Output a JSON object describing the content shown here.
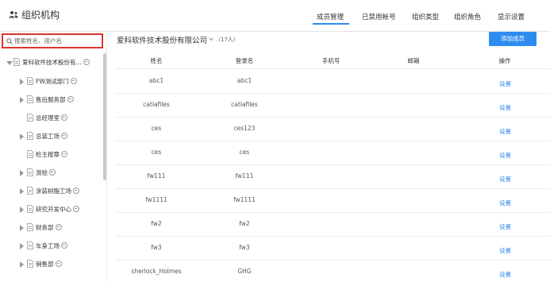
{
  "header": {
    "title": "组织机构",
    "icon": "org-users-icon",
    "tabs": [
      {
        "label": "成员管理",
        "active": true
      },
      {
        "label": "已禁用帐号",
        "active": false
      },
      {
        "label": "组织类型",
        "active": false
      },
      {
        "label": "组织角色",
        "active": false
      },
      {
        "label": "显示设置",
        "active": false
      }
    ]
  },
  "sidebar": {
    "search_placeholder": "搜索姓名、用户名",
    "tree": [
      {
        "label": "爱科软件技术股份有...",
        "level": 0,
        "expanded": true,
        "has_children": true
      },
      {
        "label": "FW测试部门",
        "level": 1,
        "has_children": true
      },
      {
        "label": "售后服务部",
        "level": 1,
        "has_children": true
      },
      {
        "label": "总经理室",
        "level": 1,
        "has_children": false
      },
      {
        "label": "总装工场",
        "level": 1,
        "has_children": true
      },
      {
        "label": "检主按章",
        "level": 1,
        "has_children": false
      },
      {
        "label": "测验",
        "level": 1,
        "has_children": true
      },
      {
        "label": "涂装树脂工场",
        "level": 1,
        "has_children": true
      },
      {
        "label": "研究开发中心",
        "level": 1,
        "has_children": true
      },
      {
        "label": "财务部",
        "level": 1,
        "has_children": true
      },
      {
        "label": "车身工场",
        "level": 1,
        "has_children": true
      },
      {
        "label": "销售部",
        "level": 1,
        "has_children": true
      }
    ]
  },
  "main": {
    "company_name": "爱科软件技术股份有限公司",
    "member_count": "（17人）",
    "add_button": "添加成员",
    "columns": {
      "name": "姓名",
      "username": "登录名",
      "phone": "手机号",
      "email": "邮箱",
      "actions": "操作"
    },
    "rows": [
      {
        "name": "abc1",
        "username": "abc1",
        "phone": "",
        "email": "",
        "action": "设置"
      },
      {
        "name": "catiafiles",
        "username": "catiafiles",
        "phone": "",
        "email": "",
        "action": "设置"
      },
      {
        "name": "ces",
        "username": "ces123",
        "phone": "",
        "email": "",
        "action": "设置"
      },
      {
        "name": "ces",
        "username": "ces",
        "phone": "",
        "email": "",
        "action": "设置"
      },
      {
        "name": "fw111",
        "username": "fw111",
        "phone": "",
        "email": "",
        "action": "设置"
      },
      {
        "name": "fw1111",
        "username": "fw1111",
        "phone": "",
        "email": "",
        "action": "设置"
      },
      {
        "name": "fw2",
        "username": "fw2",
        "phone": "",
        "email": "",
        "action": "设置"
      },
      {
        "name": "fw3",
        "username": "fw3",
        "phone": "",
        "email": "",
        "action": "设置"
      },
      {
        "name": "sherlock_Holmes",
        "username": "GHG",
        "phone": "",
        "email": "",
        "action": "设置"
      }
    ]
  },
  "colors": {
    "accent": "#2d8cf0",
    "search_highlight": "#e0342f"
  }
}
